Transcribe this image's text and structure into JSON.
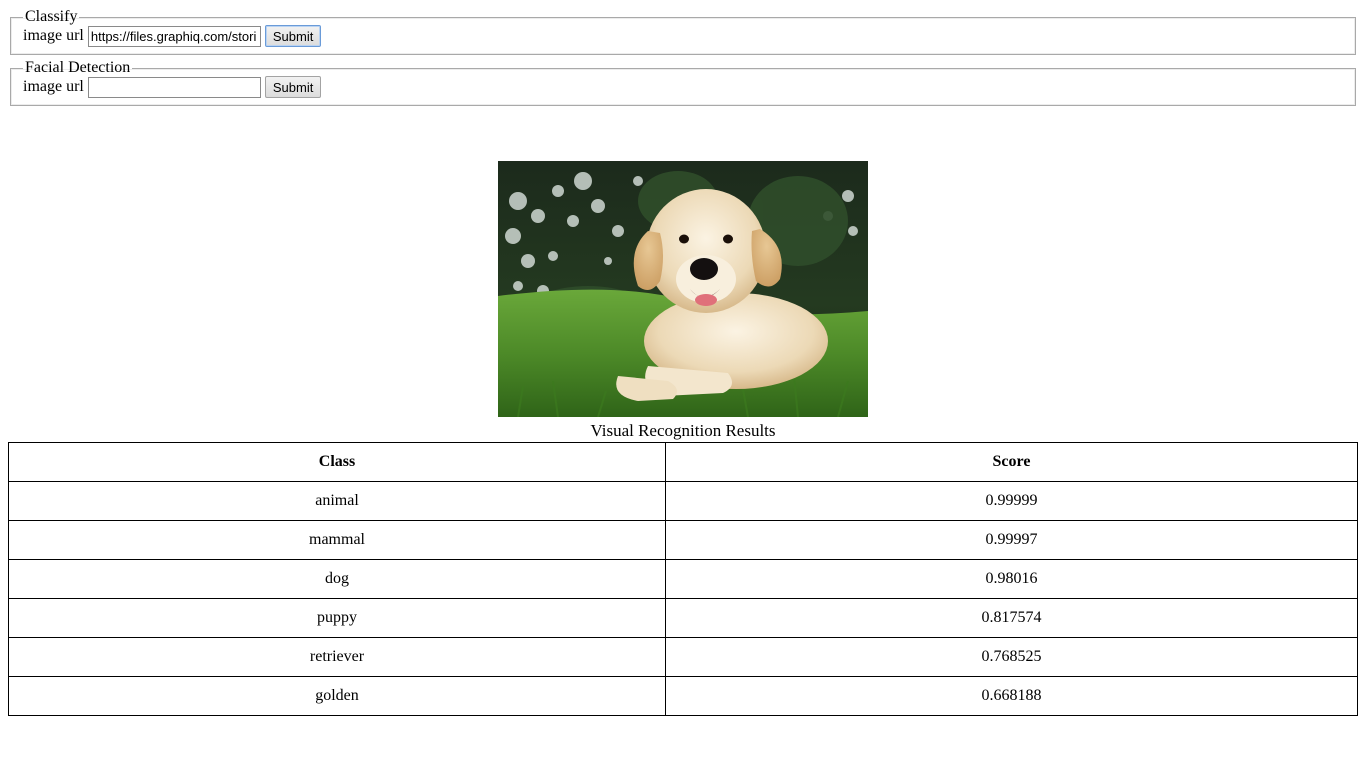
{
  "classify": {
    "legend": "Classify",
    "label": "image url",
    "url_value": "https://files.graphiq.com/stori",
    "submit_label": "Submit"
  },
  "facial": {
    "legend": "Facial Detection",
    "label": "image url",
    "url_value": "",
    "submit_label": "Submit"
  },
  "results": {
    "caption": "Visual Recognition Results",
    "headers": [
      "Class",
      "Score"
    ],
    "rows": [
      {
        "class": "animal",
        "score": "0.99999"
      },
      {
        "class": "mammal",
        "score": "0.99997"
      },
      {
        "class": "dog",
        "score": "0.98016"
      },
      {
        "class": "puppy",
        "score": "0.817574"
      },
      {
        "class": "retriever",
        "score": "0.768525"
      },
      {
        "class": "golden",
        "score": "0.668188"
      }
    ]
  },
  "image": {
    "subject": "golden retriever puppy lying on grass"
  }
}
